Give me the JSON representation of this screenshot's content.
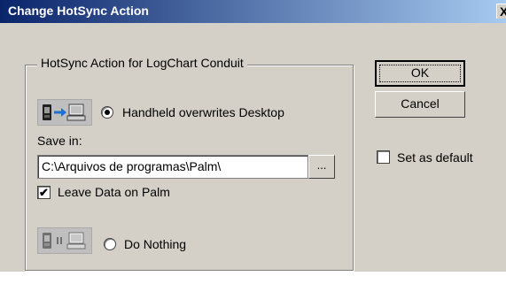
{
  "dialog": {
    "title": "Change HotSync Action",
    "close_glyph": "X"
  },
  "group": {
    "legend": "HotSync Action for LogChart Conduit",
    "option_overwrite": {
      "label": "Handheld overwrites Desktop",
      "selected": true,
      "icon": "handheld-to-desktop-icon"
    },
    "save_in_label": "Save in:",
    "save_path": "C:\\Arquivos de programas\\Palm\\",
    "browse_label": "...",
    "leave_data": {
      "label": "Leave Data on Palm",
      "checked": true
    },
    "option_nothing": {
      "label": "Do Nothing",
      "selected": false,
      "icon": "handheld-pause-desktop-icon"
    }
  },
  "buttons": {
    "ok_label": "OK",
    "cancel_label": "Cancel"
  },
  "set_default": {
    "label": "Set as default",
    "checked": false
  },
  "colors": {
    "face": "#d4d0c8",
    "title_start": "#0a246a",
    "title_end": "#a6caf0",
    "arrow": "#1e6fd8"
  }
}
